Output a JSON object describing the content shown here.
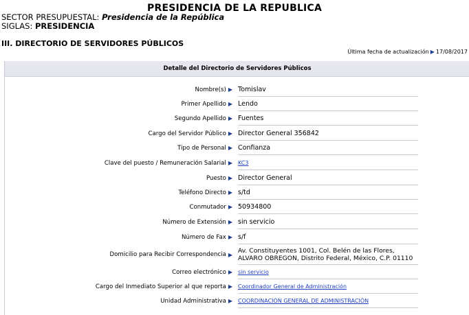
{
  "header": {
    "title": "PRESIDENCIA DE LA REPUBLICA",
    "sector_label": "SECTOR PRESUPUESTAL:",
    "sector_value": "Presidencia de la República",
    "siglas_label": "SIGLAS:",
    "siglas_value": "PRESIDENCIA"
  },
  "section": {
    "title": "III. DIRECTORIO DE SERVIDORES PÚBLICOS",
    "update_label": "Última fecha de actualización",
    "update_value": "17/08/2017"
  },
  "panel": {
    "title": "Detalle del Directorio de Servidores Públicos"
  },
  "fields": [
    {
      "label": "Nombre(s)",
      "value": "Tomislav"
    },
    {
      "label": "Primer Apellido",
      "value": "Lendo"
    },
    {
      "label": "Segundo Apellido",
      "value": "Fuentes"
    },
    {
      "label": "Cargo del Servidor Público",
      "value": "Director General 356842"
    },
    {
      "label": "Tipo de Personal",
      "value": "Confianza"
    },
    {
      "label": "Clave del puesto / Remuneración Salarial",
      "value": "KC3"
    },
    {
      "label": "Puesto",
      "value": "Director General"
    },
    {
      "label": "Teléfono Directo",
      "value": "s/td"
    },
    {
      "label": "Conmutador",
      "value": "50934800"
    },
    {
      "label": "Número de Extensión",
      "value": "sin servicio"
    },
    {
      "label": "Número de Fax",
      "value": "s/f"
    },
    {
      "label": "Domicilio para Recibir Correspondencia",
      "value": "Av. Constituyentes 1001, Col. Belén de las Flores, ALVARO OBREGON, Distrito Federal, México, C.P. 01110"
    },
    {
      "label": "Correo electrónico",
      "value": "sin servicio"
    },
    {
      "label": "Cargo del Inmediato Superior al que reporta",
      "value": "Coordinador General de Administración"
    },
    {
      "label": "Unidad Administrativa",
      "value": "COORDINACIÓN GENERAL DE ADMINISTRACIÓN"
    }
  ],
  "colors": {
    "link": "#1f3fbf",
    "arrow": "#1f3f8f",
    "panel_header_bg": "#e6e6ee"
  }
}
